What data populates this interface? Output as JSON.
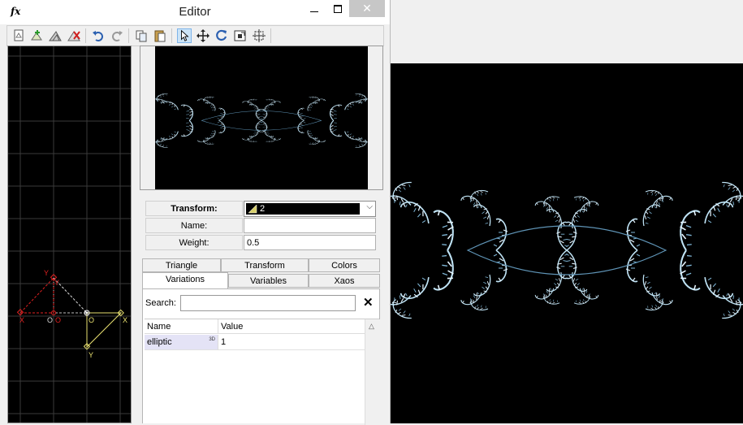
{
  "window": {
    "app_icon": "fx",
    "title": "Editor",
    "close_glyph": "✕"
  },
  "toolbar": {
    "icons": [
      "new-transform-icon",
      "add-transform-icon",
      "duplicate-transform-icon",
      "delete-transform-icon",
      "undo-icon",
      "redo-icon",
      "copy-icon",
      "paste-icon",
      "select-pointer-icon",
      "move-icon",
      "rotate-icon",
      "scale-icon",
      "flip-icon"
    ],
    "active": "select-pointer-icon"
  },
  "triangle_editor": {
    "labels": {
      "x_red": "X",
      "y_red": "Y",
      "o_red": "O",
      "x_white": "X",
      "y_white": "Y",
      "o_white": "O",
      "o_yellow": "O",
      "x_yellow": "X",
      "y_yellow": "Y"
    }
  },
  "properties": {
    "transform_label": "Transform:",
    "transform_value": "2",
    "name_label": "Name:",
    "name_value": "",
    "weight_label": "Weight:",
    "weight_value": "0.5"
  },
  "tabs": {
    "row1": [
      "Triangle",
      "Transform",
      "Colors"
    ],
    "row2": [
      "Variations",
      "Variables",
      "Xaos"
    ],
    "active": "Variations"
  },
  "variations": {
    "search_label": "Search:",
    "search_value": "",
    "clear_glyph": "✕",
    "col_name": "Name",
    "col_value": "Value",
    "rows": [
      {
        "name": "elliptic",
        "badge": "3D",
        "value": "1"
      }
    ]
  },
  "colors": {
    "fractal": "#bfe3f5",
    "fractal_dim": "#4a7fa0",
    "grid": "#3a3a3a",
    "tri_yellow": "#e8e070",
    "tri_red": "#e02020",
    "tri_white": "#d8d8d8"
  }
}
